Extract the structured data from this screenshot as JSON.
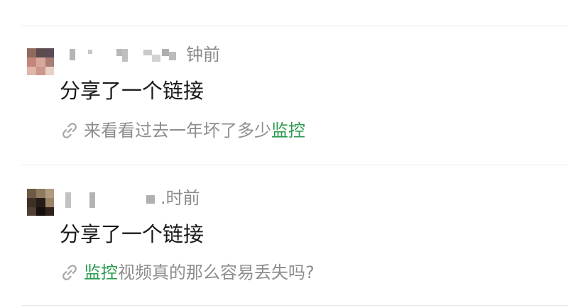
{
  "feed": {
    "items": [
      {
        "time": "钟前",
        "title": "分享了一个链接",
        "link": {
          "icon": "link-icon",
          "before": "来看看过去一年坏了多少",
          "highlight": "监控",
          "after": ""
        }
      },
      {
        "time": ".时前",
        "title": "分享了一个链接",
        "link": {
          "icon": "link-icon",
          "before": "",
          "highlight": "监控",
          "after": "视频真的那么容易丢失吗?"
        }
      }
    ]
  },
  "colors": {
    "highlight": "#2a9a4e",
    "muted_text": "#8d8d8d",
    "divider": "#e9e9e9"
  }
}
